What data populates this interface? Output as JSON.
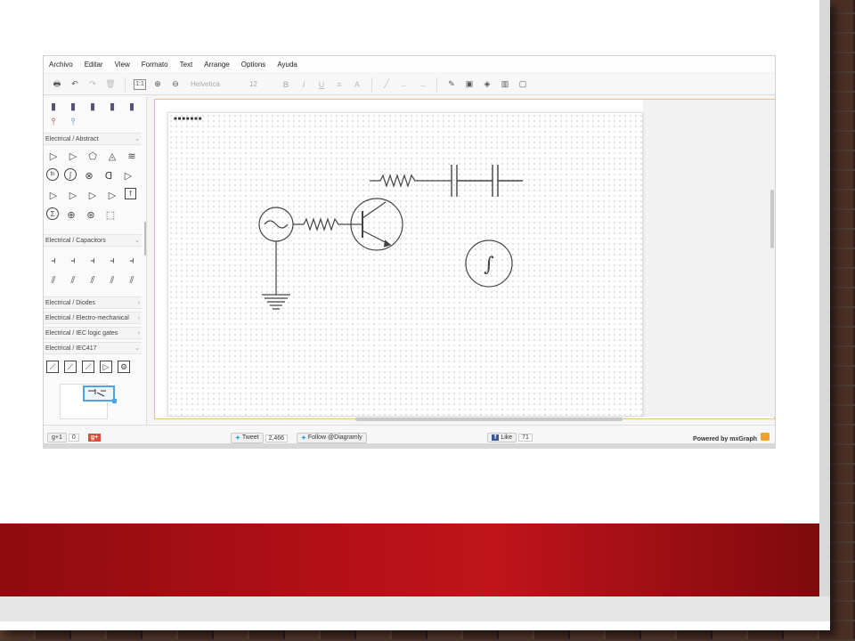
{
  "menu": [
    "Archivo",
    "Editar",
    "View",
    "Formato",
    "Text",
    "Arrange",
    "Options",
    "Ayuda"
  ],
  "toolbar": {
    "font_name": "Helvetica",
    "font_size": "12",
    "zoom_fit_label": "1:1",
    "bold": "B",
    "italic": "I",
    "underline": "U",
    "font_color": "A"
  },
  "sidebar": {
    "sections": [
      "Electrical / Abstract",
      "Electrical / Capacitors",
      "Electrical / Diodes",
      "Electrical / Electro-mechanical",
      "Electrical / IEC logic gates",
      "Electrical / IEC417"
    ],
    "abstract_symbols": [
      "fn",
      "∫",
      "Σ",
      "f"
    ]
  },
  "diagram": {
    "integral_symbol": "∫",
    "top_left_dots": "■■■■■■■"
  },
  "footer": {
    "gplus_label": "g+1",
    "gplus_count": "0",
    "gplus_badge": "g+",
    "tweet_label": "Tweet",
    "tweet_count": "2,466",
    "follow_label": "Follow @Diagramly",
    "like_label": "Like",
    "like_count": "71",
    "powered_by": "Powered by mxGraph"
  },
  "colors": {
    "slide_band": "#b21016",
    "selection": "#4ea2e6",
    "canvas_border": "#f0c080"
  }
}
